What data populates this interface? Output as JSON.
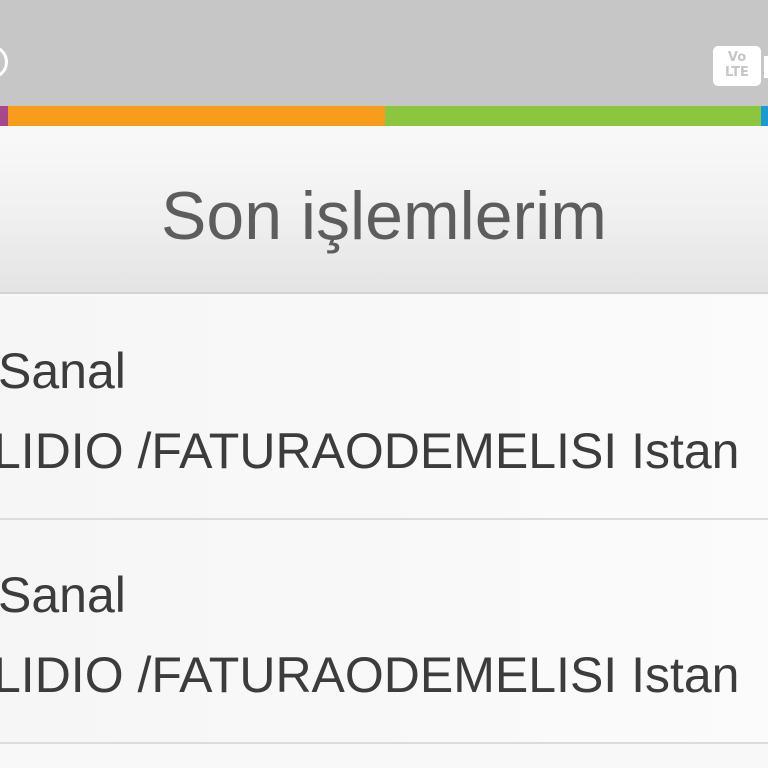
{
  "status_bar": {
    "network_badge": [
      "Vo",
      "LTE"
    ]
  },
  "brand_stripe": {
    "colors": [
      "#a9478c",
      "#f89c1c",
      "#8cc63f",
      "#1b9ad6"
    ]
  },
  "header": {
    "title": "Son işlemlerim"
  },
  "transactions": [
    {
      "title": "Sanal",
      "description": "LIDIO /FATURAODEMELISI Istan"
    },
    {
      "title": "Sanal",
      "description": "LIDIO /FATURAODEMELISI Istan"
    }
  ]
}
